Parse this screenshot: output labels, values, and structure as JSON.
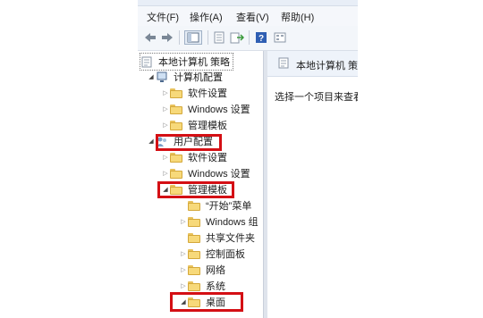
{
  "menu": [
    "文件(F)",
    "操作(A)",
    "查看(V)",
    "帮助(H)"
  ],
  "toolbar": {
    "icons": [
      "back-arrow-icon",
      "forward-arrow-icon",
      "show-hide-tree-icon",
      "properties-icon",
      "export-list-icon",
      "help-icon",
      "view-icon"
    ]
  },
  "tree": {
    "root": "本地计算机 策略",
    "computer_config": "计算机配置",
    "cc_software": "软件设置",
    "cc_windows": "Windows 设置",
    "cc_admin": "管理模板",
    "user_config": "用户配置",
    "uc_software": "软件设置",
    "uc_windows": "Windows 设置",
    "uc_admin": "管理模板",
    "start_menu": "“开始”菜单",
    "windows_components": "Windows 组",
    "shared_folders": "共享文件夹",
    "control_panel": "控制面板",
    "network": "网络",
    "system": "系统",
    "desktop": "桌面"
  },
  "right": {
    "header": "本地计算机 策",
    "hint": "选择一个项目来查看"
  },
  "highlight_color": "#d40f14"
}
